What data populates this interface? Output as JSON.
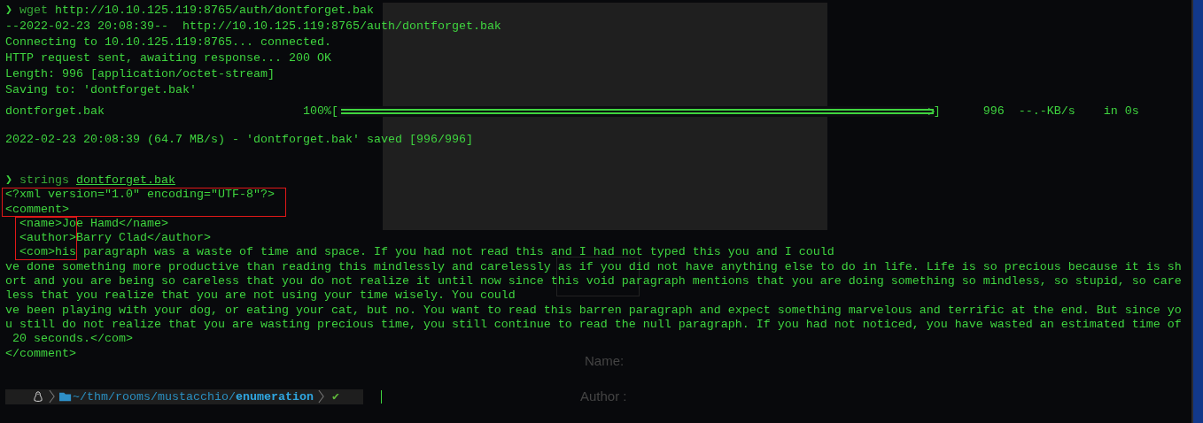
{
  "background_page": {
    "fields": [
      {
        "label": "Name:"
      },
      {
        "label": "Author :"
      }
    ]
  },
  "terminal": {
    "blocks": [
      {
        "lines": [
          {
            "kind": "command",
            "symbol": "❯",
            "program": "wget",
            "argument": "http://10.10.125.119:8765/auth/dontforget.bak",
            "argument_underlined": false
          },
          {
            "kind": "output",
            "text": "--2022-02-23 20:08:39--  http://10.10.125.119:8765/auth/dontforget.bak"
          },
          {
            "kind": "output",
            "text": "Connecting to 10.10.125.119:8765... connected."
          },
          {
            "kind": "output",
            "text": "HTTP request sent, awaiting response... 200 OK"
          },
          {
            "kind": "output",
            "text": "Length: 996 [application/octet-stream]"
          },
          {
            "kind": "output",
            "text": "Saving to: 'dontforget.bak'"
          }
        ]
      },
      {
        "lines": [
          {
            "kind": "progress",
            "file": "dontforget.bak",
            "percent": "100%[",
            "level": 1,
            "end": "]",
            "size": "996",
            "speed": "--.-KB/s",
            "time": "in 0s"
          }
        ]
      },
      {
        "lines": [
          {
            "kind": "output",
            "text": "2022-02-23 20:08:39 (64.7 MB/s) - 'dontforget.bak' saved [996/996]"
          }
        ]
      },
      {
        "lines": [
          {
            "kind": "command",
            "symbol": "❯",
            "program": "strings",
            "argument": "dontforget.bak",
            "argument_underlined": true
          },
          {
            "kind": "output",
            "text": "<?xml version=\"1.0\" encoding=\"UTF-8\"?>"
          },
          {
            "kind": "output",
            "text": "<comment>"
          },
          {
            "kind": "output",
            "text": "  <name>Joe Hamd</name>"
          },
          {
            "kind": "output",
            "text": "  <author>Barry Clad</author>"
          },
          {
            "kind": "output",
            "text": "  <com>his paragraph was a waste of time and space. If you had not read this and I had not typed this you and I could"
          },
          {
            "kind": "output",
            "text": "ve done something more productive than reading this mindlessly and carelessly as if you did not have anything else to do in life. Life is so precious because it is sh"
          },
          {
            "kind": "output",
            "text": "ort and you are being so careless that you do not realize it until now since this void paragraph mentions that you are doing something so mindless, so stupid, so care"
          },
          {
            "kind": "output",
            "text": "less that you realize that you are not using your time wisely. You could"
          },
          {
            "kind": "output",
            "text": "ve been playing with your dog, or eating your cat, but no. You want to read this barren paragraph and expect something marvelous and terrific at the end. But since yo"
          },
          {
            "kind": "output",
            "text": "u still do not realize that you are wasting precious time, you still continue to read the null paragraph. If you had not noticed, you have wasted an estimated time of"
          },
          {
            "kind": "output",
            "text": " 20 seconds.</com>"
          },
          {
            "kind": "output",
            "text": "</comment>"
          }
        ]
      }
    ],
    "prompt": {
      "path": "~/thm/rooms/mustacchio/",
      "directory": "enumeration",
      "status": "✔"
    }
  }
}
